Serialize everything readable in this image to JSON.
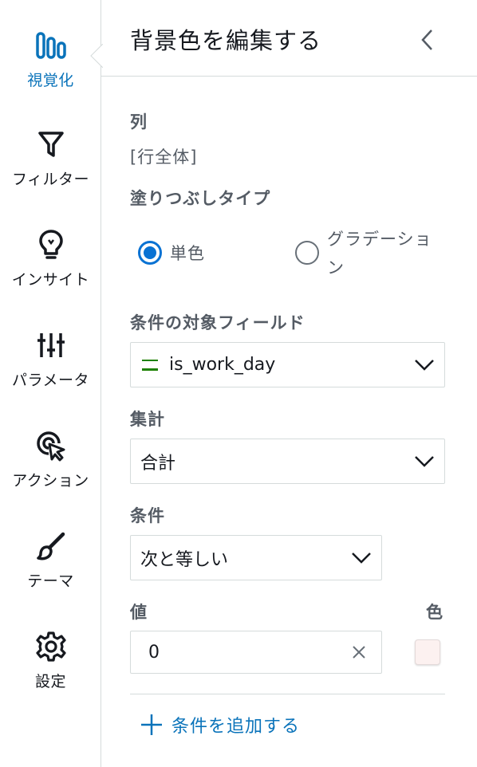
{
  "rail": {
    "items": [
      {
        "label": "視覚化",
        "icon": "bar-chart-icon",
        "active": true
      },
      {
        "label": "フィルター",
        "icon": "filter-icon"
      },
      {
        "label": "インサイト",
        "icon": "lightbulb-icon"
      },
      {
        "label": "パラメータ",
        "icon": "sliders-icon"
      },
      {
        "label": "アクション",
        "icon": "cursor-click-icon"
      },
      {
        "label": "テーマ",
        "icon": "paintbrush-icon"
      },
      {
        "label": "設定",
        "icon": "gear-icon"
      }
    ],
    "accent_color": "#0a73ba"
  },
  "panel": {
    "title": "背景色を編集する",
    "back_icon": "chevron-left-icon",
    "column": {
      "label": "列",
      "value": "[行全体]"
    },
    "fill_type": {
      "label": "塗りつぶしタイプ",
      "options": [
        {
          "label": "単色",
          "selected": true
        },
        {
          "label": "グラデーション",
          "selected": false
        }
      ]
    },
    "condition_field": {
      "label": "条件の対象フィールド",
      "value": "is_work_day",
      "icon": "dimension-equals-icon"
    },
    "aggregation": {
      "label": "集計",
      "value": "合計"
    },
    "condition": {
      "label": "条件",
      "value": "次と等しい"
    },
    "value": {
      "label": "値",
      "input_value": "0"
    },
    "color": {
      "label": "色",
      "swatch": "#fcf1f0"
    },
    "add_condition": "条件を追加する"
  }
}
